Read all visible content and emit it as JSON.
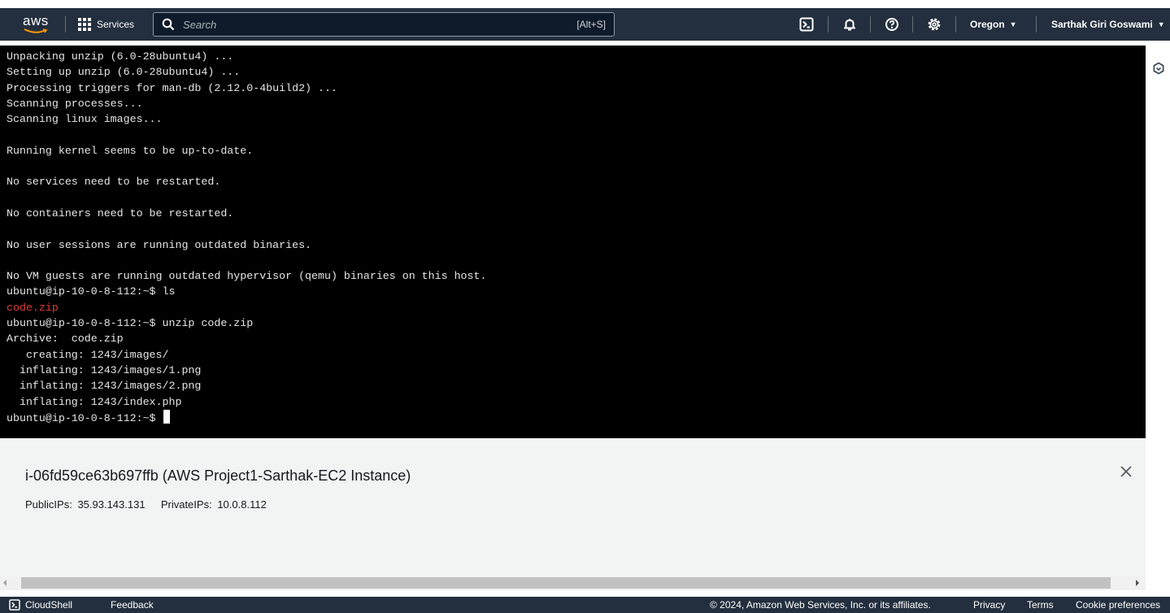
{
  "header": {
    "logo_text": "aws",
    "services_label": "Services",
    "search_placeholder": "Search",
    "search_shortcut": "[Alt+S]",
    "region": "Oregon",
    "account": "Sarthak Giri Goswami"
  },
  "terminal": {
    "lines": [
      {
        "text": "Unpacking unzip (6.0-28ubuntu4) ...",
        "color": "default"
      },
      {
        "text": "Setting up unzip (6.0-28ubuntu4) ...",
        "color": "default"
      },
      {
        "text": "Processing triggers for man-db (2.12.0-4build2) ...",
        "color": "default"
      },
      {
        "text": "Scanning processes...",
        "color": "default"
      },
      {
        "text": "Scanning linux images...",
        "color": "default"
      },
      {
        "text": "",
        "color": "default"
      },
      {
        "text": "Running kernel seems to be up-to-date.",
        "color": "default"
      },
      {
        "text": "",
        "color": "default"
      },
      {
        "text": "No services need to be restarted.",
        "color": "default"
      },
      {
        "text": "",
        "color": "default"
      },
      {
        "text": "No containers need to be restarted.",
        "color": "default"
      },
      {
        "text": "",
        "color": "default"
      },
      {
        "text": "No user sessions are running outdated binaries.",
        "color": "default"
      },
      {
        "text": "",
        "color": "default"
      },
      {
        "text": "No VM guests are running outdated hypervisor (qemu) binaries on this host.",
        "color": "default"
      },
      {
        "text": "ubuntu@ip-10-0-8-112:~$ ls",
        "color": "default"
      },
      {
        "text": "code.zip",
        "color": "red"
      },
      {
        "text": "ubuntu@ip-10-0-8-112:~$ unzip code.zip",
        "color": "default"
      },
      {
        "text": "Archive:  code.zip",
        "color": "default"
      },
      {
        "text": "   creating: 1243/images/",
        "color": "default"
      },
      {
        "text": "  inflating: 1243/images/1.png",
        "color": "default"
      },
      {
        "text": "  inflating: 1243/images/2.png",
        "color": "default"
      },
      {
        "text": "  inflating: 1243/index.php",
        "color": "default"
      }
    ],
    "prompt": "ubuntu@ip-10-0-8-112:~$ ",
    "colors": {
      "background": "#000000",
      "text": "#e6e6e6",
      "red": "#e03a3a"
    }
  },
  "instance": {
    "title": "i-06fd59ce63b697ffb (AWS Project1-Sarthak-EC2 Instance)",
    "public_label": "PublicIPs:",
    "public_ip": "35.93.143.131",
    "private_label": "PrivateIPs:",
    "private_ip": "10.0.8.112"
  },
  "footer": {
    "cloudshell": "CloudShell",
    "feedback": "Feedback",
    "copyright": "© 2024, Amazon Web Services, Inc. or its affiliates.",
    "privacy": "Privacy",
    "terms": "Terms",
    "cookie": "Cookie preferences"
  },
  "icons": {
    "nav": [
      "cloudshell-icon",
      "bell-icon",
      "help-icon",
      "settings-icon"
    ],
    "rail": "hexagon-icon",
    "close": "close-icon"
  },
  "colors": {
    "nav_bg": "#232f3e",
    "panel_bg": "#f2f3f3",
    "aws_orange": "#ff9900"
  }
}
